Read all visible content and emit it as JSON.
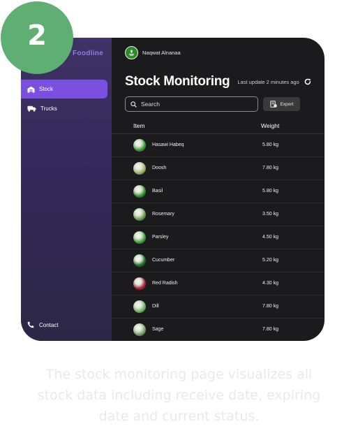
{
  "badge": {
    "number": "2",
    "color": "#5fae73"
  },
  "sidebar": {
    "brand": "Foodline",
    "items": [
      {
        "label": "Stock",
        "icon": "warehouse-icon",
        "active": true
      },
      {
        "label": "Trucks",
        "icon": "truck-icon",
        "active": false
      }
    ],
    "footer": {
      "label": "Contact",
      "icon": "phone-icon"
    }
  },
  "header": {
    "user_name": "Naqwat Alnanaa",
    "title": "Stock Monitoring",
    "last_update": "Last update 2 minutes ago",
    "refresh_icon": "refresh-icon"
  },
  "toolbar": {
    "search_placeholder": "Search",
    "export_label": "Export"
  },
  "table": {
    "columns": [
      "Item",
      "Weight"
    ],
    "rows": [
      {
        "item": "Hasawi Habeq",
        "weight": "5.80 kg",
        "color": "#3e9a3a"
      },
      {
        "item": "Doosh",
        "weight": "7.80 kg",
        "color": "#9fb06a"
      },
      {
        "item": "Basil",
        "weight": "5.80 kg",
        "color": "#2f8f2a"
      },
      {
        "item": "Rosemary",
        "weight": "3.50 kg",
        "color": "#6f9a5a"
      },
      {
        "item": "Parsley",
        "weight": "4.50 kg",
        "color": "#3da13a"
      },
      {
        "item": "Cucumber",
        "weight": "5.20 kg",
        "color": "#1f6b2a"
      },
      {
        "item": "Red Radish",
        "weight": "4.30 kg",
        "color": "#b0203c"
      },
      {
        "item": "Dill",
        "weight": "7.80 kg",
        "color": "#6fb060"
      },
      {
        "item": "Sage",
        "weight": "7.80 kg",
        "color": "#7c9c68"
      }
    ]
  },
  "caption": [
    "The stock monitoring page visualizes all",
    "stock data including receive date, expiring",
    "date and current status."
  ],
  "colors": {
    "accent": "#7b4fe0",
    "brand": "#8a7ce8",
    "background": "#1b1b1d"
  }
}
